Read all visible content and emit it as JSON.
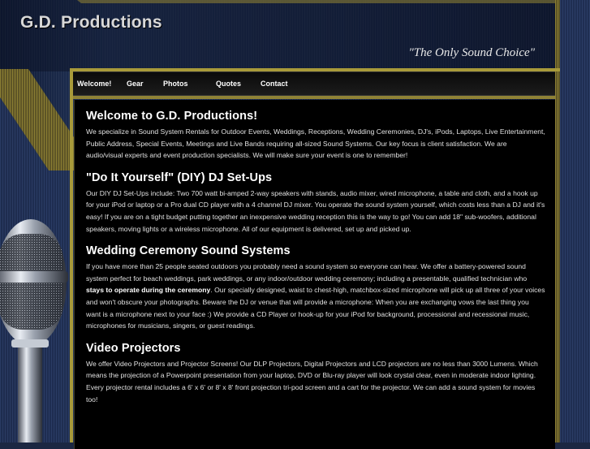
{
  "header": {
    "site_title": "G.D. Productions",
    "tagline": "\"The Only Sound Choice\""
  },
  "nav": {
    "items": [
      {
        "label": "Welcome!"
      },
      {
        "label": "Gear"
      },
      {
        "label": "Photos"
      },
      {
        "label": "Quotes"
      },
      {
        "label": "Contact"
      }
    ]
  },
  "sections": {
    "welcome": {
      "heading": "Welcome to G.D. Productions!",
      "body": "We specialize in Sound System Rentals for Outdoor Events, Weddings, Receptions, Wedding Ceremonies, DJ's, iPods, Laptops, Live Entertainment, Public Address, Special Events, Meetings and Live Bands requiring all-sized Sound Systems. Our key focus is client satisfaction. We are audio/visual experts and event production specialists. We will make sure your event is one to remember!"
    },
    "diy": {
      "heading": "\"Do It Yourself\" (DIY) DJ Set-Ups",
      "body": "Our DIY DJ Set-Ups include: Two 700 watt bi-amped 2-way speakers with stands, audio mixer, wired microphone, a table and cloth, and a hook up for your iPod or laptop or a Pro dual CD player with a 4 channel DJ mixer. You operate the sound system yourself, which costs less than a DJ and it's easy!  If you are on a tight budget putting together an inexpensive wedding reception this is the way to go! You can add 18\" sub-woofers, additional speakers, moving lights or a wireless microphone. All of our equipment is delivered, set up and picked up."
    },
    "ceremony": {
      "heading": "Wedding Ceremony Sound Systems",
      "body_before": "If you have more than 25 people seated outdoors you probably need a sound system so everyone can hear. We offer a battery-powered sound system perfect for beach weddings, park weddings, or any indoor/outdoor wedding ceremony; including a presentable, qualified technician who ",
      "body_bold": "stays to operate during the ceremony",
      "body_after": ". Our specially designed, waist to chest-high, matchbox-sized microphone will pick up all three of your voices and won't obscure your photographs. Beware the DJ or venue that will provide a microphone: When you are exchanging vows the last thing you want is a microphone next to your face :) We provide a CD Player or hook-up for your iPod for background, processional and recessional music, microphones for musicians, singers, or guest readings."
    },
    "projectors": {
      "heading": "Video Projectors",
      "body": "We offer Video Projectors and Projector Screens! Our DLP Projectors, Digital Projectors and LCD projectors are no less than 3000 Lumens. Which means the projection of a Powerpoint presentation from your laptop,  DVD or Blu-ray player will look crystal clear, even in moderate indoor lighting. Every projector rental includes a 6' x 6' or 8' x 8' front projection tri-pod screen and a cart for the projector. We can add a sound system for movies too!"
    }
  },
  "colors": {
    "accent_gold": "#a89a3a",
    "background_navy": "#1b2742",
    "content_bg": "#000000"
  }
}
